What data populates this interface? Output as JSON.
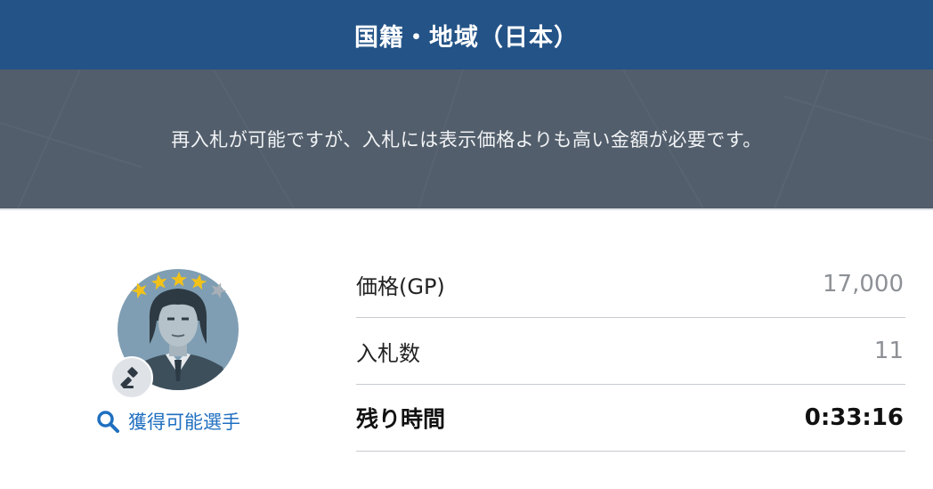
{
  "header": {
    "title": "国籍・地域（日本）"
  },
  "notice": {
    "message": "再入札が可能ですが、入札には表示価格よりも高い金額が必要です。"
  },
  "player": {
    "rating_stars_filled": 4,
    "rating_stars_total": 5,
    "obtainable_link_label": "獲得可能選手"
  },
  "auction": {
    "price_label": "価格(GP)",
    "price_value": "17,000",
    "bids_label": "入札数",
    "bids_value": "11",
    "time_label": "残り時間",
    "time_value": "0:33:16"
  },
  "icons": {
    "search": "search-icon",
    "gavel": "gavel-icon",
    "star": "star-icon"
  },
  "colors": {
    "header_bg": "#235387",
    "notice_bg": "#525e6b",
    "link_blue": "#1f6fc0",
    "star_gold": "#f2c21b",
    "star_grey": "#a9b0b7"
  }
}
